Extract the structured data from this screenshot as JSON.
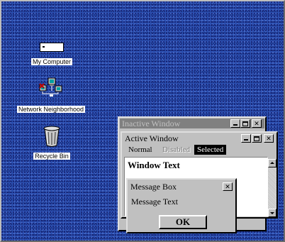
{
  "desktop_icons": {
    "my_computer": "My Computer",
    "network_neighborhood": "Network Neighborhood",
    "recycle_bin": "Recycle Bin"
  },
  "inactive_window": {
    "title": "Inactive Window"
  },
  "active_window": {
    "title": "Active Window",
    "menu": {
      "normal": "Normal",
      "disabled": "Disabled",
      "selected": "Selected"
    },
    "window_text": "Window Text"
  },
  "message_box": {
    "title": "Message Box",
    "text": "Message Text",
    "ok_label": "OK"
  },
  "colors": {
    "desktop": "#2b4fb0",
    "inactive_title": "#808080",
    "active_title": "#c0c0c0",
    "selected_bg": "#000000",
    "selected_text": "#ffffff",
    "disabled_text": "#808080"
  }
}
